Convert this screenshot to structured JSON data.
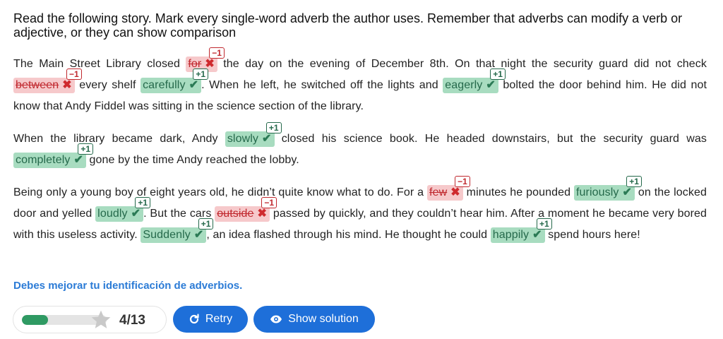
{
  "instructions": "Read the following story. Mark every single-word adverb the author uses. Remember that adverbs can modify a verb or adjective, or they can show comparison",
  "paragraphs": [
    [
      {
        "t": "The Main Street Library closed "
      },
      {
        "m": "for",
        "s": "wrong",
        "b": "−1"
      },
      {
        "t": " the day on the evening of December 8th. On that night the security guard did not check "
      },
      {
        "m": "between",
        "s": "wrong",
        "b": "−1"
      },
      {
        "t": " every shelf "
      },
      {
        "m": "carefully",
        "s": "correct",
        "b": "+1"
      },
      {
        "t": ". When he left, he switched off the lights and "
      },
      {
        "m": "eagerly",
        "s": "correct",
        "b": "+1"
      },
      {
        "t": " bolted the door behind him. He did not know that Andy Fiddel was sitting in the science section of the library."
      }
    ],
    [
      {
        "t": "When the library became dark, Andy "
      },
      {
        "m": "slowly",
        "s": "correct",
        "b": "+1"
      },
      {
        "t": " closed his science book. He headed downstairs, but the security guard was "
      },
      {
        "m": "completely",
        "s": "correct",
        "b": "+1"
      },
      {
        "t": " gone by the time Andy reached the lobby."
      }
    ],
    [
      {
        "t": "Being only a young boy of eight years old, he didn’t quite know what to do. For a "
      },
      {
        "m": "few",
        "s": "wrong",
        "b": "−1"
      },
      {
        "t": " minutes he pounded "
      },
      {
        "m": "furiously",
        "s": "correct",
        "b": "+1"
      },
      {
        "t": " on the locked door and yelled "
      },
      {
        "m": "loudly",
        "s": "correct",
        "b": "+1"
      },
      {
        "t": ". But the cars "
      },
      {
        "m": "outside",
        "s": "wrong",
        "b": "−1"
      },
      {
        "t": " passed by quickly, and they couldn’t hear him. After a moment he became very bored with this useless activity. "
      },
      {
        "m": "Suddenly",
        "s": "correct",
        "b": "+1"
      },
      {
        "t": ", an idea flashed through his mind. He thought he could "
      },
      {
        "m": "happily",
        "s": "correct",
        "b": "+1"
      },
      {
        "t": " spend hours here!"
      }
    ]
  ],
  "feedback": "Debes mejorar tu identificación de adverbios.",
  "score": {
    "text": "4/13",
    "progress": 0.31
  },
  "buttons": {
    "retry": "Retry",
    "show_solution": "Show solution"
  },
  "colors": {
    "accent": "#1e6fd9",
    "correct": "#a8dcc0",
    "wrong": "#f6c9cb",
    "feedback": "#2b7bd6"
  },
  "icons": {
    "correct": "check-icon",
    "wrong": "cross-icon",
    "retry": "retry-icon",
    "solution": "eye-icon",
    "score": "star-icon"
  }
}
